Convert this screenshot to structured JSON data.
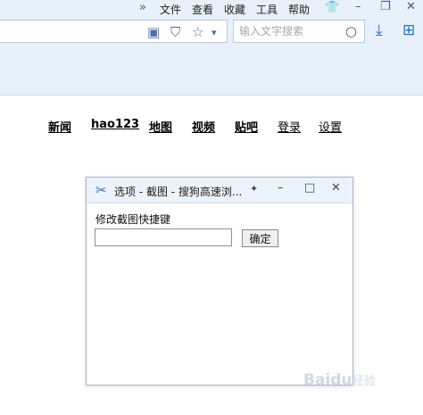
{
  "menubar": {
    "overflow_glyph": "»",
    "items": [
      "文件",
      "查看",
      "收藏",
      "工具",
      "帮助"
    ],
    "skin_glyph": "👕",
    "minimize_glyph": "–",
    "restore_glyph": "❐",
    "close_glyph": "✕"
  },
  "toolbar": {
    "addr_icons": [
      "▣",
      "⛉",
      "☆",
      "▾"
    ],
    "search_placeholder": "输入文字搜索",
    "search_glyph": "○",
    "download_glyph": "⤓",
    "apps_glyph": "⊞"
  },
  "nav": {
    "links": [
      "新闻",
      "hao123",
      "地图",
      "视频",
      "贴吧"
    ],
    "login": "登录",
    "settings": "设置"
  },
  "dialog": {
    "title": "选项 - 截图 - 搜狗高速浏...",
    "icon_glyph": "✂",
    "pin_glyph": "✦",
    "minimize_glyph": "–",
    "maximize_glyph": "□",
    "close_glyph": "✕",
    "label": "修改截图快捷键",
    "input_value": "",
    "ok_label": "确定"
  },
  "watermark": {
    "brand": "Baidu",
    "suffix": "经验"
  }
}
